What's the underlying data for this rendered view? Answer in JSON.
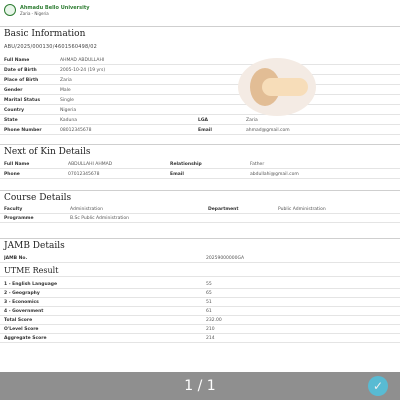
{
  "header": {
    "university": "Ahmadu Bello University",
    "city": "Zaria - Nigeria"
  },
  "basic": {
    "title": "Basic Information",
    "application_id": "ABU/2025/000130/4601560498/02",
    "rows": [
      {
        "label": "Full Name",
        "value": "AHMAD ABDULLAHI"
      },
      {
        "label": "Date of Birth",
        "value": "2005-10-24 (19 yrs)"
      },
      {
        "label": "Place of Birth",
        "value": "Zaria"
      },
      {
        "label": "Gender",
        "value": "Male"
      },
      {
        "label": "Marital Status",
        "value": "Single"
      },
      {
        "label": "Country",
        "value": "Nigeria"
      }
    ],
    "state_row": {
      "label": "State",
      "value": "Kaduna",
      "label2": "LGA",
      "value2": "Zaria"
    },
    "phone_row": {
      "label": "Phone Number",
      "value": "08012345678",
      "label2": "Email",
      "value2": "ahmad@gmail.com"
    }
  },
  "kin": {
    "title": "Next of Kin Details",
    "row1": {
      "label": "Full Name",
      "value": "ABDULLAHI AHMAD",
      "label2": "Relationship",
      "value2": "Father"
    },
    "row2": {
      "label": "Phone",
      "value": "07012345678",
      "label2": "Email",
      "value2": "abdullahi@gmail.com"
    }
  },
  "course": {
    "title": "Course Details",
    "header": {
      "c1": "Faculty",
      "c2": "Administration",
      "c3": "Department",
      "c4": "Public Administration"
    },
    "row": {
      "label": "Programme",
      "value": "B.Sc Public Administration"
    }
  },
  "jamb": {
    "title": "JAMB Details",
    "reg_label": "JAMB No.",
    "reg_value": "20259000000GA",
    "utme_title": "UTME Result",
    "subjects": [
      {
        "label": "1 - English Language",
        "value": "55"
      },
      {
        "label": "2 - Geography",
        "value": "65"
      },
      {
        "label": "3 - Economics",
        "value": "51"
      },
      {
        "label": "4 - Government",
        "value": "61"
      }
    ],
    "extra": [
      {
        "label": "Total Score",
        "value": "232.00"
      },
      {
        "label": "O'Level Score",
        "value": "210"
      },
      {
        "label": "Aggregate Score",
        "value": "214"
      }
    ]
  },
  "viewer": {
    "page_counter": "1 / 1",
    "check_icon": "✓"
  }
}
